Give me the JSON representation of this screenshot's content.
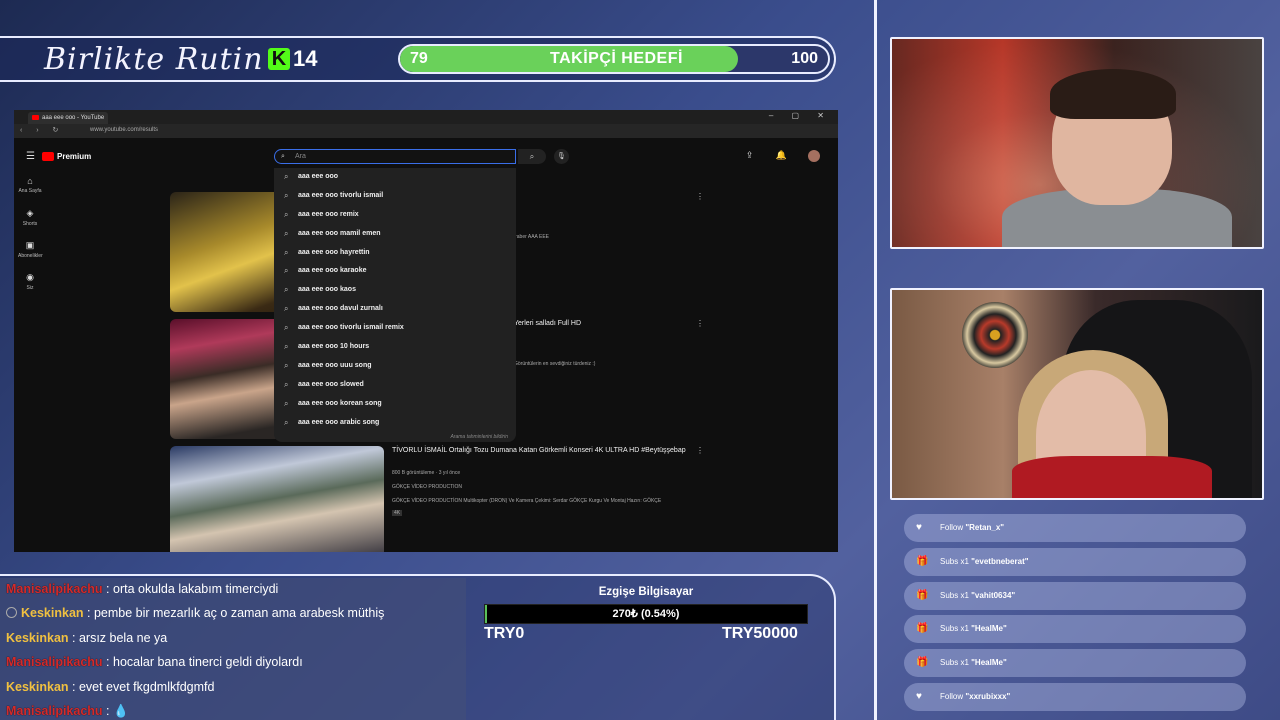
{
  "header": {
    "brand": "Birlikte Rutin",
    "kick_logo": "K",
    "kick_count": "14",
    "goal": {
      "start": "79",
      "label": "TAKİPÇİ HEDEFİ",
      "end": "100",
      "progress_fraction": 0.79
    }
  },
  "browser": {
    "tab_title": "aaa eee ooo - YouTube",
    "url": "www.youtube.com/results",
    "search_placeholder": "Ara",
    "logo_text": "Premium",
    "sidebar": [
      {
        "icon": "home-icon",
        "label": "Ana Sayfa"
      },
      {
        "icon": "shorts-icon",
        "label": "Shorts"
      },
      {
        "icon": "subscriptions-icon",
        "label": "Abonelikler"
      },
      {
        "icon": "you-icon",
        "label": "Siz"
      }
    ],
    "suggestions": [
      "aaa eee ooo",
      "aaa eee ooo tivorlu ismail",
      "aaa eee ooo remix",
      "aaa eee ooo mamil emen",
      "aaa eee ooo hayrettin",
      "aaa eee ooo karaoke",
      "aaa eee ooo kaos",
      "aaa eee ooo davul zurnalı",
      "aaa eee ooo tivorlu ismail remix",
      "aaa eee ooo 10 hours",
      "aaa eee ooo uuu song",
      "aaa eee ooo slowed",
      "aaa eee ooo korean song",
      "aaa eee ooo arabic song"
    ],
    "report_link": "Arama tahminlerini bildirin",
    "videos": [
      {
        "title": "",
        "meta": "",
        "desc": "remiter AAA EEE - Tivorlu İsmail Tivorlu İsmail - Hep Beraber AAA EEE"
      },
      {
        "title": "Yerleri salladı Full HD",
        "meta": "",
        "desc": "Görüntülerin en sevdiğiniz türdeniz :)"
      },
      {
        "title": "TİVORLU İSMAİL Ortalığı Tozu Dumana Katan Görkemli Konseri 4K ULTRA HD #Beytüşşebap",
        "meta": "800 B görüntüleme · 3 yıl önce",
        "channel": "GÖKÇE VİDEO PRODUCTION",
        "desc": "GÖKÇE VİDEO PRODUCTİON Multikopter (DRON) Ve Kamera Çekimi: Serdar GÖKÇE Kurgu Ve Montaj Hazırı: GÖKÇE",
        "badge": "4K"
      }
    ]
  },
  "events": [
    {
      "type": "Follow",
      "icon": "heart-icon",
      "prefix": "Follow",
      "user": "\"Retan_x\""
    },
    {
      "type": "Subs",
      "icon": "gift-icon",
      "prefix": "Subs x1",
      "user": "\"evetbneberat\""
    },
    {
      "type": "Subs",
      "icon": "gift-icon",
      "prefix": "Subs x1",
      "user": "\"vahit0634\""
    },
    {
      "type": "Subs",
      "icon": "gift-icon",
      "prefix": "Subs x1",
      "user": "\"HealMe\""
    },
    {
      "type": "Subs",
      "icon": "gift-icon",
      "prefix": "Subs x1",
      "user": "\"HealMe\""
    },
    {
      "type": "Follow",
      "icon": "heart-icon",
      "prefix": "Follow",
      "user": "\"xxrubixxx\""
    }
  ],
  "chat": [
    {
      "user": "Manisalipikachu",
      "color": "red",
      "message": ": orta okulda lakabım timerciydi"
    },
    {
      "user": "Keskinkan",
      "color": "gold",
      "badge": true,
      "message": ": pembe bir mezarlık aç o zaman ama arabesk müthiş"
    },
    {
      "user": "Keskinkan",
      "color": "gold",
      "message": ": arsız bela ne ya"
    },
    {
      "user": "Manisalipikachu",
      "color": "red",
      "message": ": hocalar bana tinerci geldi diyolardı"
    },
    {
      "user": "Keskinkan",
      "color": "gold",
      "message": ": evet evet fkgdmlkfdgmfd"
    },
    {
      "user": "Manisalipikachu",
      "color": "red",
      "message": ": 💧"
    }
  ],
  "donation": {
    "title": "Ezgişe Bilgisayar",
    "amount": "270₺ (0.54%)",
    "progress_fraction": 0.0054,
    "min": "TRY0",
    "max": "TRY50000"
  },
  "colors": {
    "goal_fill": "#6ad15a",
    "kick": "#53fc18",
    "chat_red": "#d42a2a",
    "chat_gold": "#f0c040",
    "search_focus": "#3a6ee8"
  }
}
